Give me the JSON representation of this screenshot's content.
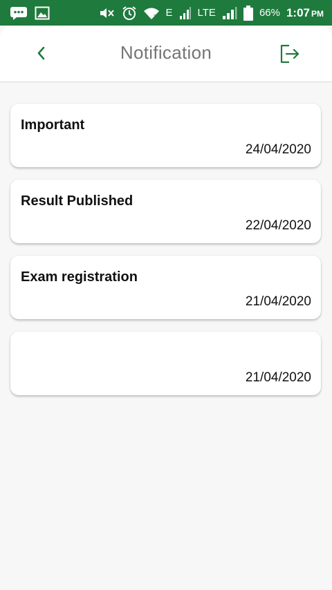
{
  "status_bar": {
    "battery": "66%",
    "network_e": "E",
    "network_lte": "LTE",
    "time": "1:07",
    "ampm": "PM",
    "icons": [
      "chat-icon",
      "image-icon",
      "mute-icon",
      "alarm-icon",
      "wifi-icon",
      "signal-icon",
      "battery-icon"
    ]
  },
  "header": {
    "title": "Notification",
    "accent_color": "#1f7a3d"
  },
  "notifications": [
    {
      "title": "Important",
      "date": "24/04/2020"
    },
    {
      "title": "Result Published",
      "date": "22/04/2020"
    },
    {
      "title": "Exam registration",
      "date": "21/04/2020"
    },
    {
      "title": "",
      "date": "21/04/2020"
    }
  ]
}
